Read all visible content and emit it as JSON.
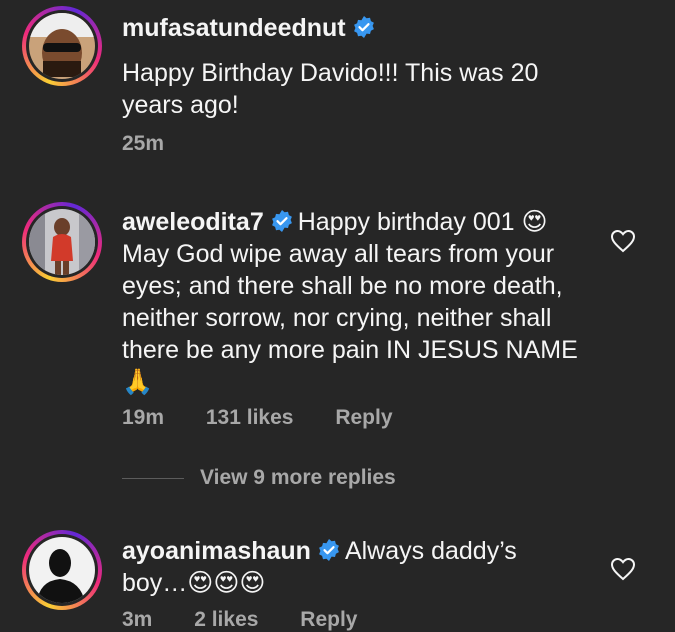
{
  "comments": [
    {
      "username": "mufasatundeednut",
      "text": "Happy Birthday Davido!!! This was 20 years ago!",
      "time": "25m",
      "likes": "",
      "reply": ""
    },
    {
      "username": "aweleodita7",
      "text": "Happy birthday 001 😍 May God wipe away all tears from your eyes; and there shall be no more death, neither sorrow, nor crying, neither shall there be any more pain IN JESUS NAME 🙏",
      "time": "19m",
      "likes": "131 likes",
      "reply": "Reply"
    },
    {
      "username": "ayoanimashaun",
      "text": "Always daddy’s boy…😍😍😍",
      "time": "3m",
      "likes": "2 likes",
      "reply": "Reply"
    }
  ],
  "view_more": "View 9 more replies",
  "colors": {
    "background": "#262626",
    "text": "#f5f5f5",
    "meta": "#a8a8a8",
    "verified": "#3897f0"
  },
  "icons": [
    "verified-badge-icon",
    "heart-icon"
  ]
}
